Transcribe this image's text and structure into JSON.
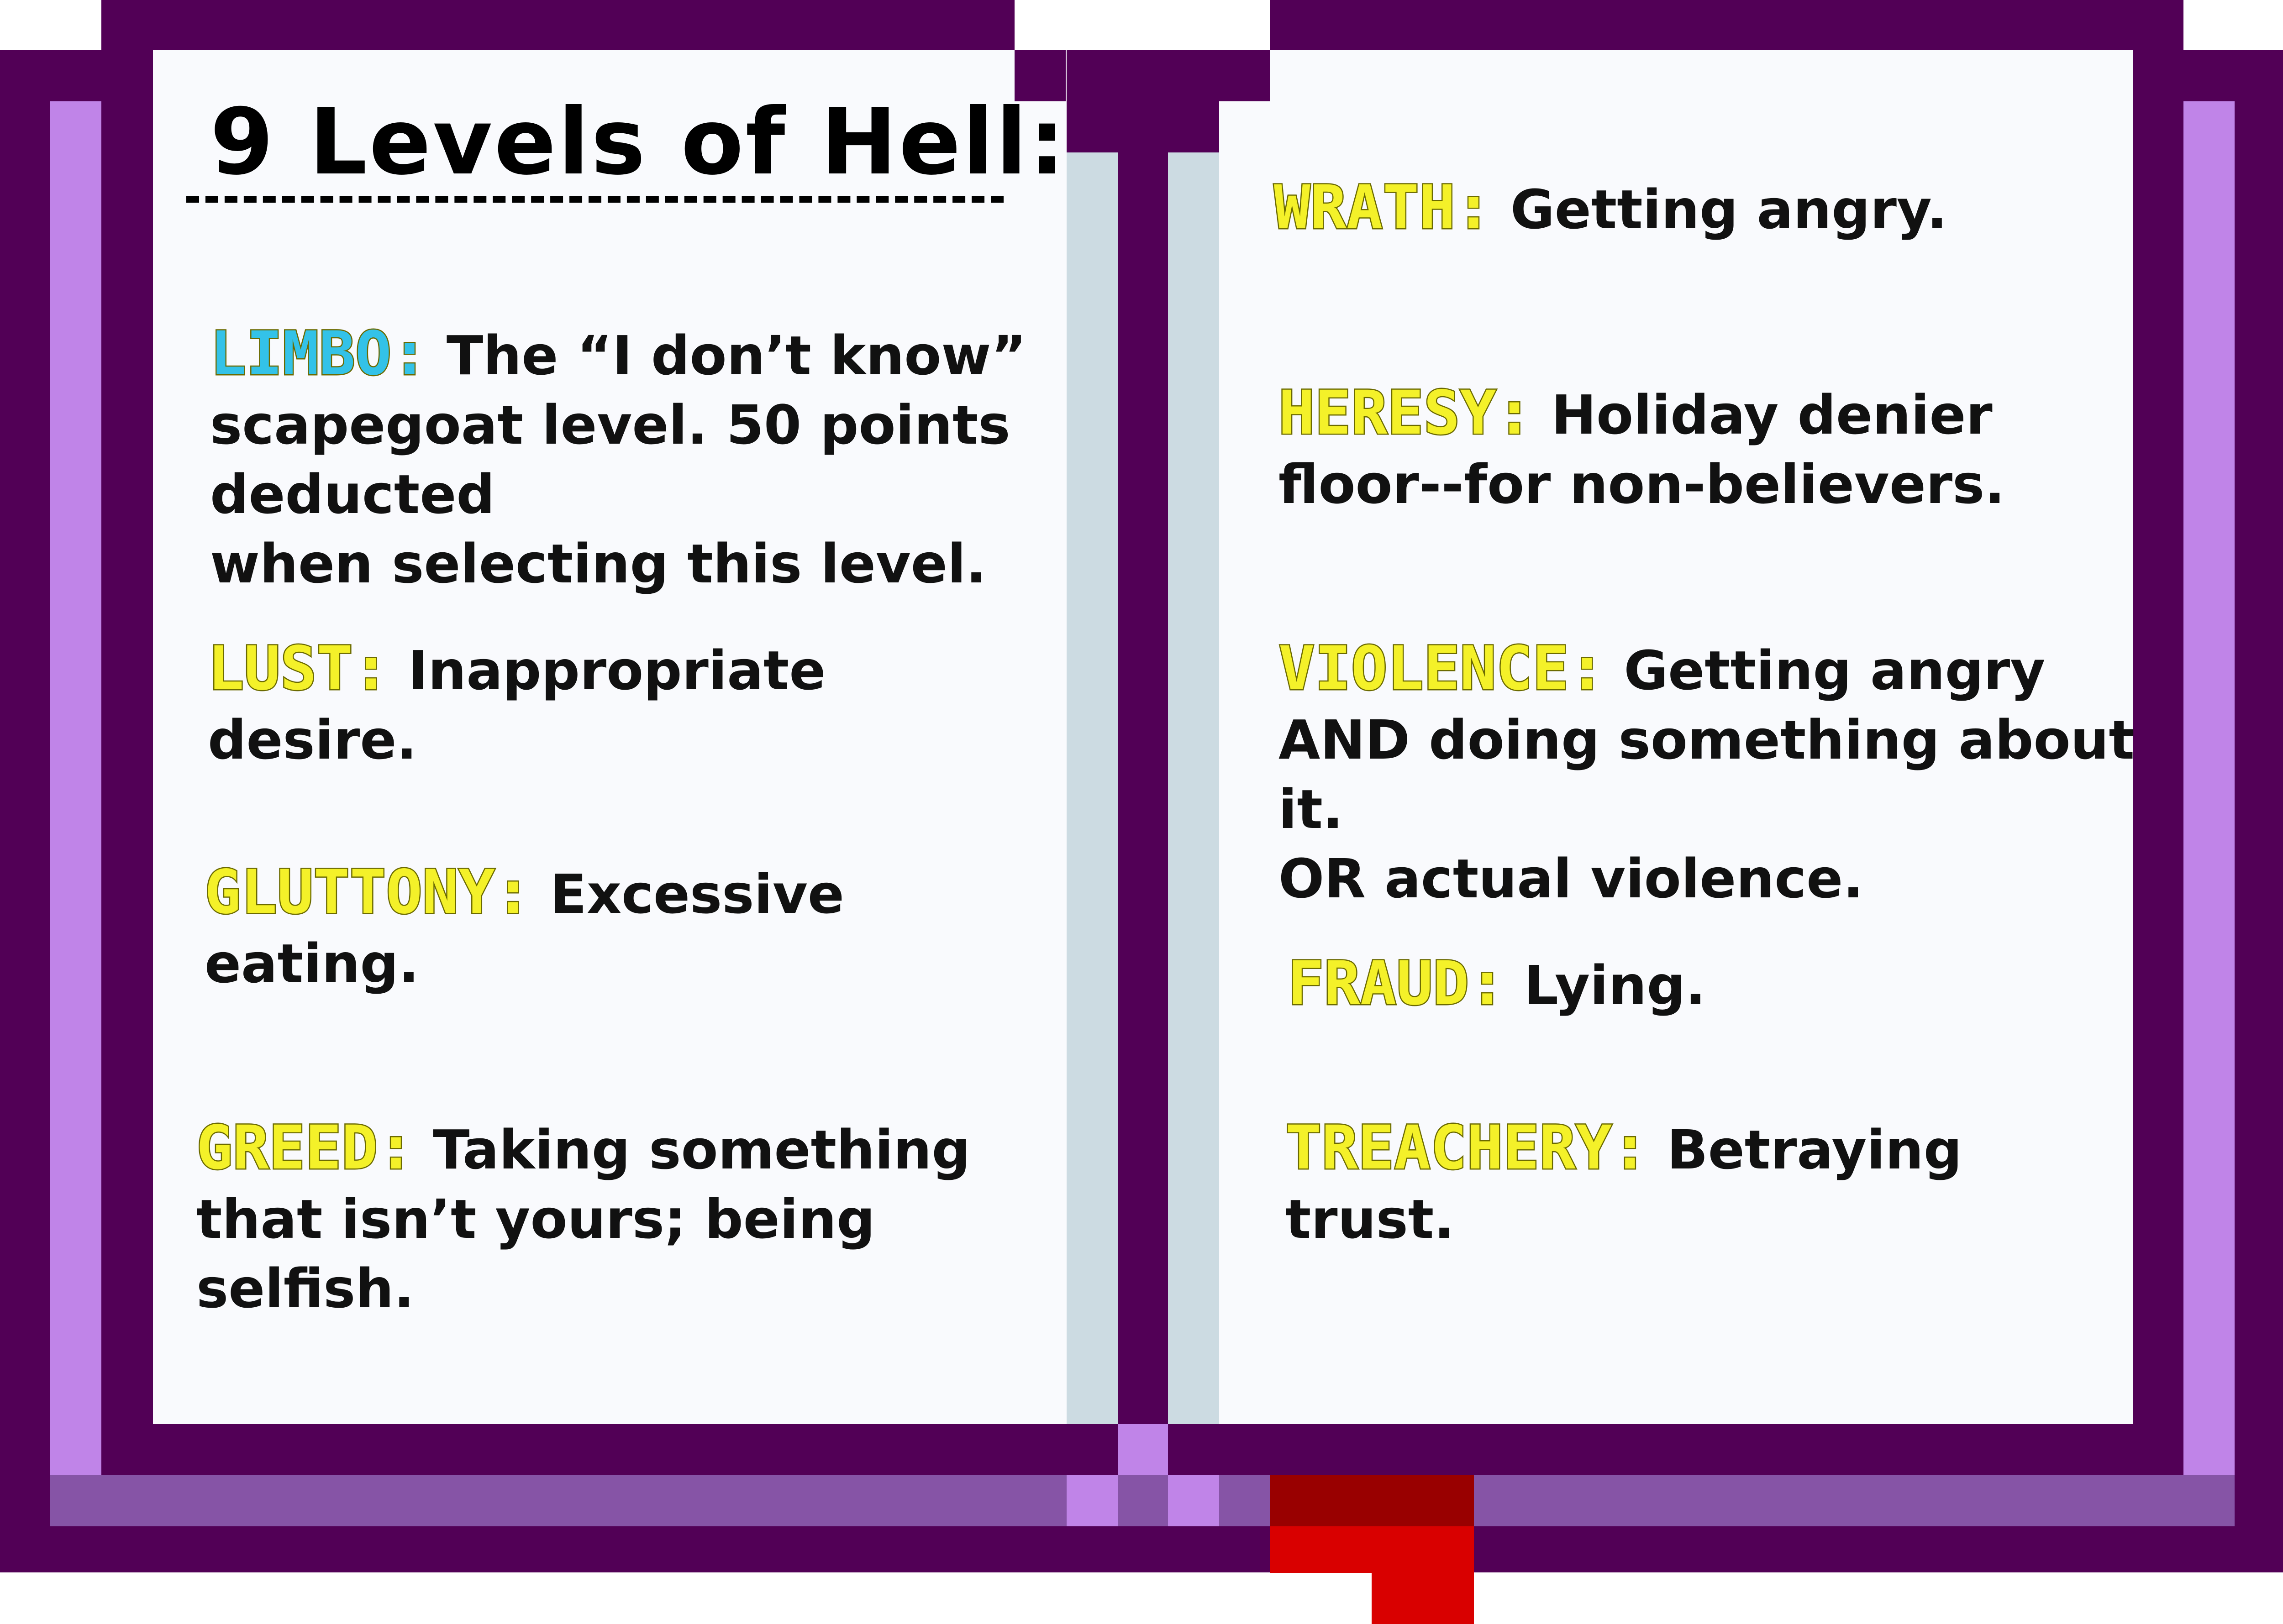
{
  "title": "9 Levels of Hell:",
  "colors": {
    "book_dark": "#520056",
    "book_light": "#c084e8",
    "book_band": "#8654a6",
    "page": "#f9fafd",
    "spine_page": "#ccdbe2",
    "term_yellow": "#f4f129",
    "term_cyan": "#33c2e8",
    "bookmark_dark": "#990000",
    "bookmark_red": "#d90000"
  },
  "left_page": [
    {
      "term": "LIMBO:",
      "term_color": "#33c2e8",
      "lines": [
        "The “I don’t know”",
        "scapegoat level. 50 points deducted",
        "when selecting this level."
      ]
    },
    {
      "term": "LUST:",
      "term_color": "#f4f129",
      "lines": [
        "Inappropriate desire."
      ]
    },
    {
      "term": "GLUTTONY:",
      "term_color": "#f4f129",
      "lines": [
        "Excessive",
        "eating."
      ]
    },
    {
      "term": "GREED:",
      "term_color": "#f4f129",
      "lines": [
        "Taking something",
        "that isn’t yours; being selfish."
      ]
    }
  ],
  "right_page": [
    {
      "term": "WRATH:",
      "term_color": "#f4f129",
      "lines": [
        "Getting angry."
      ]
    },
    {
      "term": "HERESY:",
      "term_color": "#f4f129",
      "lines": [
        "Holiday denier",
        "floor--for non-believers."
      ]
    },
    {
      "term": "VIOLENCE:",
      "term_color": "#f4f129",
      "lines": [
        "Getting angry",
        "AND doing something about it.",
        "OR actual violence."
      ]
    },
    {
      "term": "FRAUD:",
      "term_color": "#f4f129",
      "lines": [
        "Lying."
      ]
    },
    {
      "term": "TREACHERY:",
      "term_color": "#f4f129",
      "lines": [
        "Betraying",
        "trust."
      ]
    }
  ]
}
